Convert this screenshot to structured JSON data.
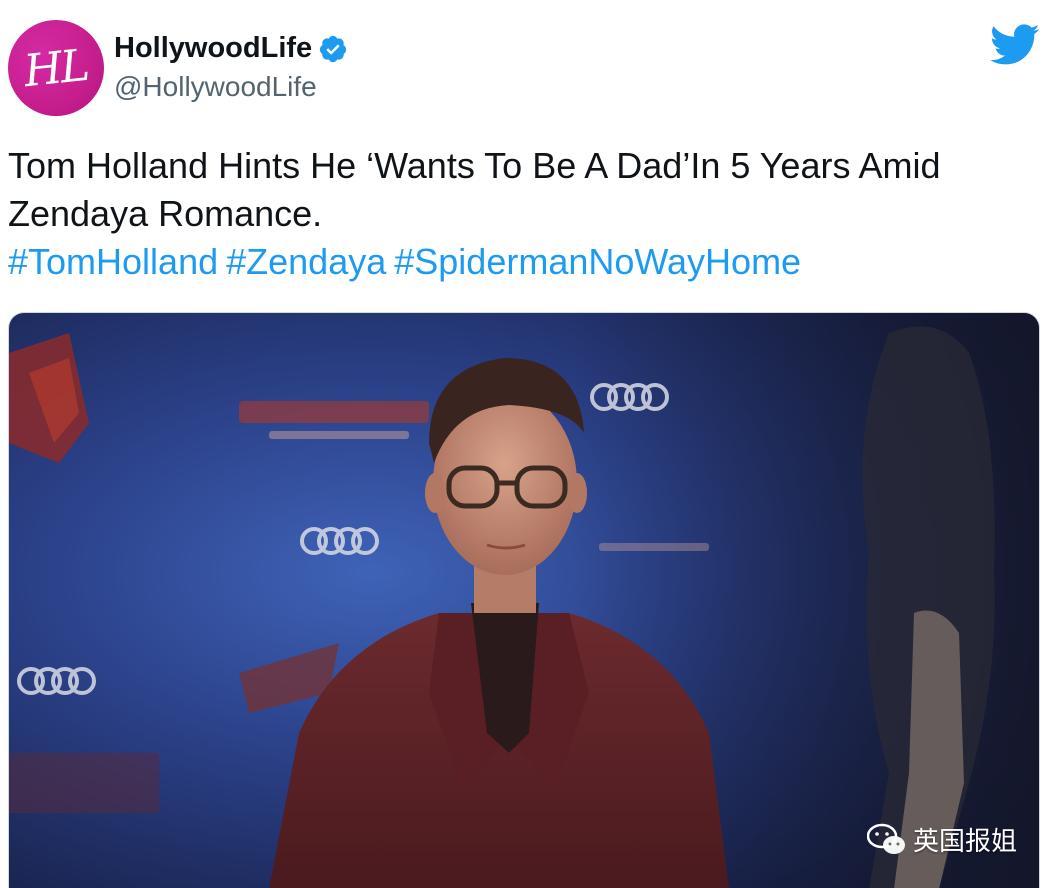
{
  "account": {
    "avatar_text": "HL",
    "display_name": "HollywoodLife",
    "handle": "@HollywoodLife",
    "verified": true
  },
  "tweet": {
    "text": "Tom Holland Hints He ‘Wants To Be A Dad’In 5 Years Amid Zendaya Romance.",
    "hashtags": [
      "#TomHolland",
      "#Zendaya",
      "#SpidermanNoWayHome"
    ]
  },
  "media": {
    "watermark_text": "英国报姐"
  },
  "colors": {
    "brand_pink": "#c81f8f",
    "twitter_blue": "#1d9bf0",
    "text_primary": "#0f1419",
    "text_secondary": "#536471"
  },
  "icons": {
    "verified": "verified-badge-icon",
    "twitter": "twitter-bird-icon",
    "watermark": "wechat-icon"
  }
}
